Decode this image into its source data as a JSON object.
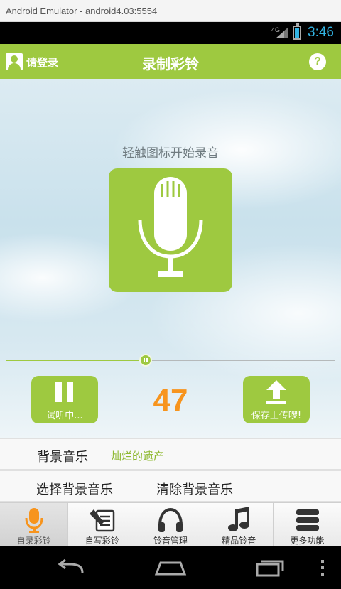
{
  "emulator": {
    "title": "Android Emulator - android4.03:5554"
  },
  "status_bar": {
    "network": "4G",
    "time": "3:46",
    "battery_color": "#33b5e5"
  },
  "header": {
    "login_label": "请登录",
    "title": "录制彩铃",
    "help_symbol": "?"
  },
  "recorder": {
    "hint": "轻触图标开始录音",
    "progress": 0.425,
    "pause_label": "试听中...",
    "count": "47",
    "save_label": "保存上传啰!"
  },
  "background_music": {
    "label": "背景音乐",
    "current": "灿烂的遗产",
    "choose_label": "选择背景音乐",
    "clear_label": "清除背景音乐"
  },
  "tabs": [
    {
      "label": "自录彩铃",
      "icon": "microphone-icon",
      "active": true
    },
    {
      "label": "自写彩铃",
      "icon": "write-icon",
      "active": false
    },
    {
      "label": "铃音管理",
      "icon": "headphones-icon",
      "active": false
    },
    {
      "label": "精品铃音",
      "icon": "music-note-icon",
      "active": false
    },
    {
      "label": "更多功能",
      "icon": "menu-stack-icon",
      "active": false
    }
  ],
  "colors": {
    "brand_green": "#9ec940",
    "counter_orange": "#f7941d",
    "accent_green_text": "#8db82e"
  }
}
